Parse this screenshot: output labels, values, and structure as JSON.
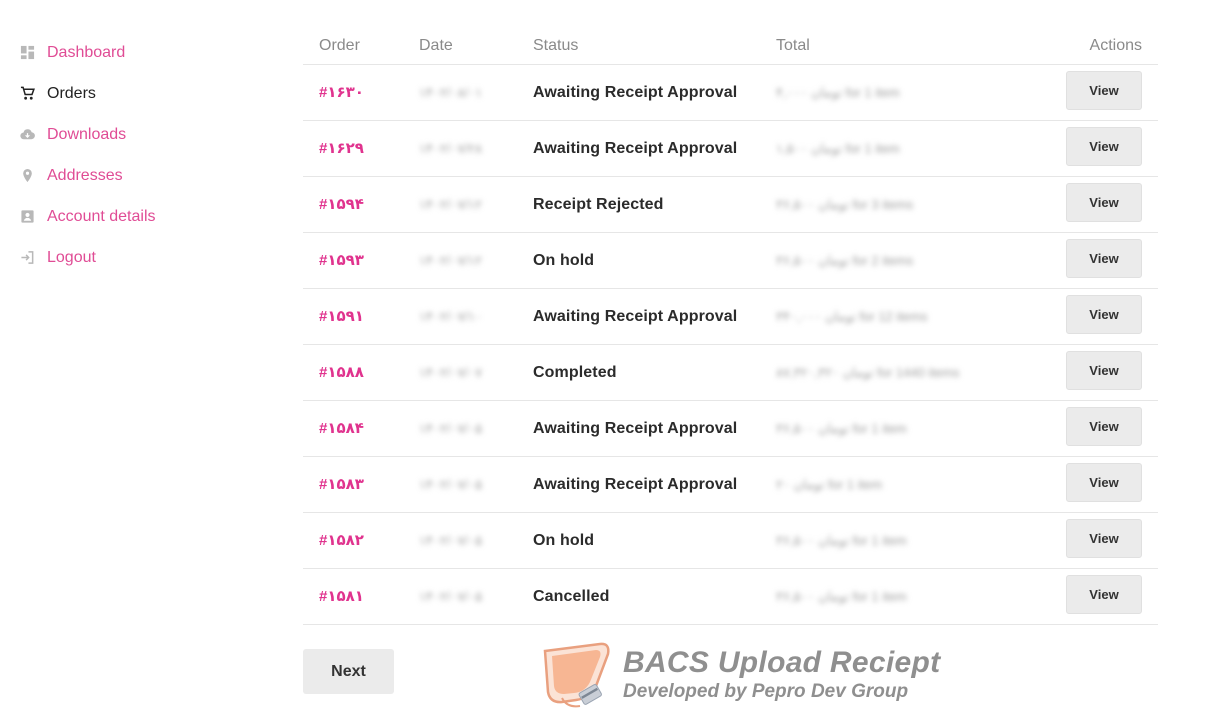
{
  "sidebar": {
    "items": [
      {
        "label": "Dashboard",
        "icon": "dashboard-icon",
        "active": false
      },
      {
        "label": "Orders",
        "icon": "cart-icon",
        "active": true
      },
      {
        "label": "Downloads",
        "icon": "cloud-download-icon",
        "active": false
      },
      {
        "label": "Addresses",
        "icon": "location-pin-icon",
        "active": false
      },
      {
        "label": "Account details",
        "icon": "account-card-icon",
        "active": false
      },
      {
        "label": "Logout",
        "icon": "logout-icon",
        "active": false
      }
    ]
  },
  "table": {
    "headers": {
      "order": "Order",
      "date": "Date",
      "status": "Status",
      "total": "Total",
      "actions": "Actions"
    },
    "rows": [
      {
        "order": "#۱۶۳۰",
        "date": "۱۴۰۲/۰۸/۰۱",
        "status": "Awaiting Receipt Approval",
        "total": "۴,۰۰۰ تومان for 1 item",
        "action": "View"
      },
      {
        "order": "#۱۶۲۹",
        "date": "۱۴۰۲/۰۷/۲۸",
        "status": "Awaiting Receipt Approval",
        "total": "۱,۵۰۰ تومان for 1 item",
        "action": "View"
      },
      {
        "order": "#۱۵۹۴",
        "date": "۱۴۰۲/۰۷/۱۲",
        "status": "Receipt Rejected",
        "total": "۳۶,۵۰۰ تومان for 3 items",
        "action": "View"
      },
      {
        "order": "#۱۵۹۳",
        "date": "۱۴۰۲/۰۷/۱۲",
        "status": "On hold",
        "total": "۳۶,۵۰۰ تومان for 2 items",
        "action": "View"
      },
      {
        "order": "#۱۵۹۱",
        "date": "۱۴۰۲/۰۷/۱۰",
        "status": "Awaiting Receipt Approval",
        "total": "۳۴۰,۰۰۰ تومان for 12 items",
        "action": "View"
      },
      {
        "order": "#۱۵۸۸",
        "date": "۱۴۰۲/۰۷/۰۷",
        "status": "Completed",
        "total": "۸۷,۳۲۰,۳۲۰ تومان for 1440 items",
        "action": "View"
      },
      {
        "order": "#۱۵۸۴",
        "date": "۱۴۰۲/۰۷/۰۵",
        "status": "Awaiting Receipt Approval",
        "total": "۳۶,۵۰۰ تومان for 1 item",
        "action": "View"
      },
      {
        "order": "#۱۵۸۳",
        "date": "۱۴۰۲/۰۷/۰۵",
        "status": "Awaiting Receipt Approval",
        "total": "۲۰ تومان for 1 item",
        "action": "View"
      },
      {
        "order": "#۱۵۸۲",
        "date": "۱۴۰۲/۰۷/۰۵",
        "status": "On hold",
        "total": "۳۶,۵۰۰ تومان for 1 item",
        "action": "View"
      },
      {
        "order": "#۱۵۸۱",
        "date": "۱۴۰۲/۰۷/۰۵",
        "status": "Cancelled",
        "total": "۳۶,۵۰۰ تومان for 1 item",
        "action": "View"
      }
    ]
  },
  "pagination": {
    "next_label": "Next"
  },
  "watermark": {
    "title": "BACS Upload Reciept",
    "subtitle": "Developed by Pepro Dev Group"
  },
  "colors": {
    "accent": "#e0338e",
    "text": "#2b2b2b",
    "muted": "#8a8a8a",
    "button_bg": "#ebebeb"
  }
}
